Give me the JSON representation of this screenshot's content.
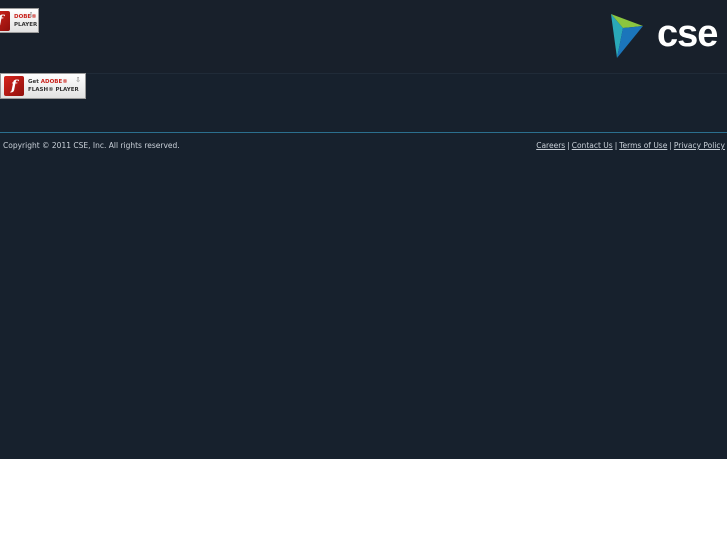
{
  "flash_badges": [
    {
      "line1": "Get ",
      "line1_red": "ADOBE®",
      "line2": "FLASH® PLAYER"
    },
    {
      "line1": "Get ",
      "line1_red": "ADOBE®",
      "line2": "FLASH® PLAYER"
    }
  ],
  "flash_top_visible": {
    "line1_red": "DOBE®",
    "line2": "PLAYER"
  },
  "logo": {
    "text": "cse",
    "icon": "cse-logo-icon"
  },
  "footer": {
    "copyright": "Copyright © 2011 CSE, Inc. All rights reserved.",
    "links": [
      "Careers",
      "Contact Us",
      "Terms of Use",
      "Privacy Policy"
    ],
    "separator": "|"
  },
  "colors": {
    "background": "#17212d",
    "header": "#18202b",
    "divider": "#2b6f8e",
    "logo_green": "#8bc53f",
    "logo_blue": "#1b75bb",
    "logo_teal": "#2aa8b8"
  }
}
